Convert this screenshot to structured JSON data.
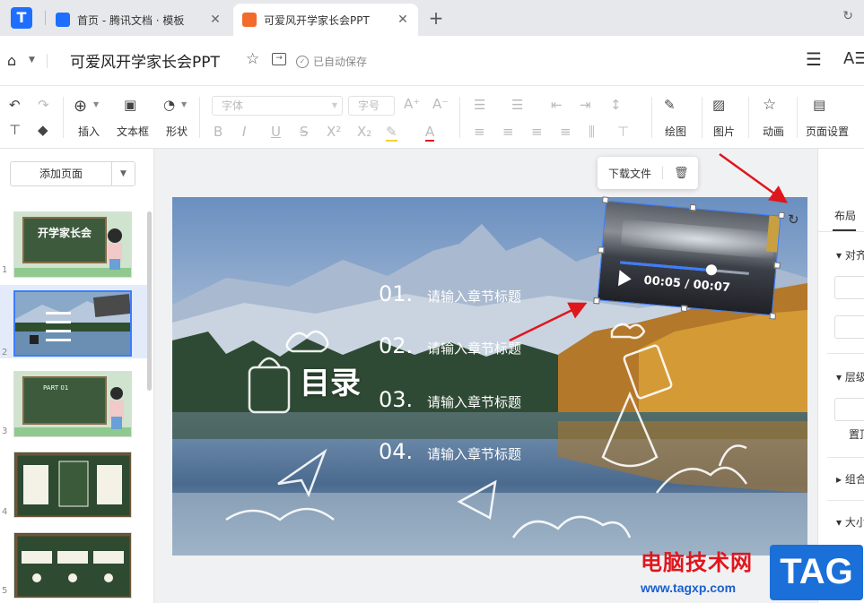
{
  "tabs": [
    {
      "label": "首页 - 腾讯文档 · 模板"
    },
    {
      "label": "可爱风开学家长会PPT"
    }
  ],
  "doc": {
    "title": "可爱风开学家长会PPT",
    "save_status": "已自动保存"
  },
  "toolbar": {
    "insert_label": "插入",
    "textbox_label": "文本框",
    "shape_label": "形状",
    "font_placeholder": "字体",
    "size_placeholder": "字号",
    "draw_label": "绘图",
    "image_label": "图片",
    "animation_label": "动画",
    "page_setup_label": "页面设置"
  },
  "left_panel": {
    "add_page_label": "添加页面",
    "thumbnails": [
      {
        "num": "1",
        "title": "开学家长会",
        "bg": "#3d5a3d"
      },
      {
        "num": "2",
        "title": "",
        "bg": "#6c8db0"
      },
      {
        "num": "3",
        "title": "PART 01",
        "bg": "#3d5a3d"
      },
      {
        "num": "4",
        "title": "",
        "bg": "#2e4a30"
      },
      {
        "num": "5",
        "title": "",
        "bg": "#2e4a30"
      }
    ]
  },
  "slide": {
    "heading": "目录",
    "items": [
      {
        "num": "01.",
        "text": "请输入章节标题"
      },
      {
        "num": "02.",
        "text": "请输入章节标题"
      },
      {
        "num": "03.",
        "text": "请输入章节标题"
      },
      {
        "num": "04.",
        "text": "请输入章节标题"
      }
    ],
    "video_time": "00:05 / 00:07",
    "video_progress": 0.71
  },
  "popbar": {
    "download_label": "下载文件"
  },
  "right_panel": {
    "tab": "布局",
    "sections": [
      "对齐",
      "层级",
      "置顶",
      "组合",
      "大小"
    ]
  },
  "watermark": {
    "site_name": "电脑技术网",
    "url": "www.tagxp.com",
    "tag": "TAG"
  },
  "colors": {
    "accent": "#3d7dff",
    "tab_active": "#ffffff",
    "arrow": "#e0161d"
  }
}
